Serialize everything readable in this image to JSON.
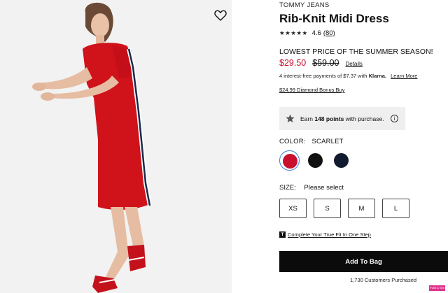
{
  "product": {
    "brand": "TOMMY JEANS",
    "title": "Rib-Knit Midi Dress",
    "stars": "★★★★★",
    "rating": "4.6",
    "review_count": "(80)"
  },
  "pricing": {
    "promo": "LOWEST PRICE OF THE SUMMER SEASON!",
    "sale_price": "$29.50",
    "original_price": "$59.00",
    "details_link": "Details",
    "installments_text": "4 interest-free payments of $7.37 with",
    "installments_provider": "Klarna.",
    "learn_more": "Learn More",
    "bonus_buy": "$24.99 Diamond Bonus Buy"
  },
  "points": {
    "prefix": "Earn",
    "amount": "148 points",
    "suffix": "with purchase.",
    "info_glyph": "i"
  },
  "color": {
    "label": "COLOR:",
    "selected": "SCARLET",
    "swatches": [
      {
        "name": "Scarlet",
        "hex": "#c8102e",
        "selected": true
      },
      {
        "name": "Black",
        "hex": "#111111",
        "selected": false
      },
      {
        "name": "Navy",
        "hex": "#121a2e",
        "selected": false
      }
    ]
  },
  "size": {
    "label": "SIZE:",
    "prompt": "Please select",
    "options": [
      "XS",
      "S",
      "M",
      "L"
    ]
  },
  "fit": {
    "icon_glyph": "T",
    "link": "Complete Your True Fit In One Step"
  },
  "cart": {
    "button": "Add To Bag",
    "purchased": "1,730 Customers Purchased"
  },
  "badge": {
    "text": "Point & Win"
  },
  "colors": {
    "accent_red": "#c8102e",
    "button_black": "#0b0b0b",
    "swatch_selected_ring": "#3f7fd6",
    "badge_pink": "#e0338a"
  },
  "icons": {
    "wishlist": "heart-outline-icon",
    "points": "star-icon",
    "info": "info-circle-icon",
    "fit": "true-fit-icon"
  }
}
